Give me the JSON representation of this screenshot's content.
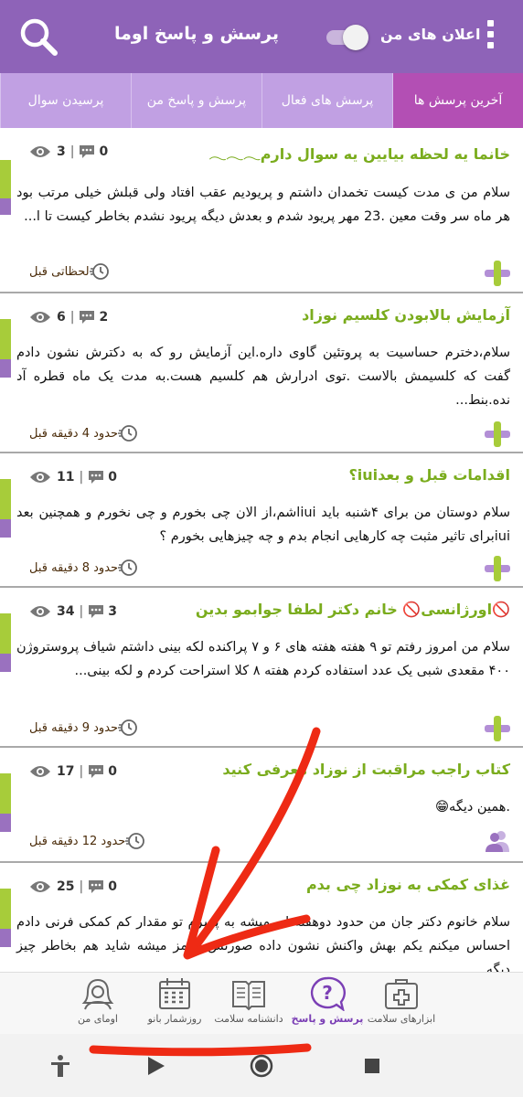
{
  "appbar": {
    "title": "پرسش و پاسخ اوما",
    "notifications_label": "اعلان های من",
    "notifications_on": true
  },
  "tabs": [
    {
      "label": "آخرین پرسش ها",
      "active": true
    },
    {
      "label": "پرسش های فعال",
      "active": false
    },
    {
      "label": "پرسش و پاسخ من",
      "active": false
    },
    {
      "label": "پرسیدن سوال",
      "active": false
    }
  ],
  "questions": [
    {
      "title": "خانما یه لحظه بیایین یه سوال دارم𓂃𓂃𓂃",
      "body": "سلام من ی مدت کیست تخمدان داشتم و پریودیم عقب افتاد ولی قبلش خیلی مرتب بود هر ماه سر وقت معین .23 مهر پریود شدم و بعدش دیگه پریود نشدم بخاطر کیست تا ا...",
      "views": "3",
      "answers": "0",
      "time": "لحظاتی قبل",
      "avatar": "cross-icon"
    },
    {
      "title": "آزمایش بالابودن کلسیم نوزاد",
      "body": "سلام،دخترم حساسیت به پروتئین گاوی داره.این آزمایش رو که به دکترش نشون دادم گفت که کلسیمش بالاست .توی ادرارش هم کلسیم هست.به مدت یک ماه قطره آد نده.بنط...",
      "views": "6",
      "answers": "2",
      "time": "حدود 4 دقیقه قبل",
      "avatar": "cross-icon"
    },
    {
      "title": "اقدامات قبل و بعدiui؟",
      "body": "سلام دوستان  من برای ۴شنبه باید iuiاشم،از الان چی بخورم و چی نخورم و همچنین بعد iuiبرای تاثیر مثبت چه کارهایی انجام بدم و چه چیزهایی بخورم ؟",
      "views": "11",
      "answers": "0",
      "time": "حدود 8 دقیقه قبل",
      "avatar": "cross-icon"
    },
    {
      "title": "🚫اورژانسی🚫 خانم دکتر لطفا جوابمو بدین",
      "body": "سلام من امروز رفتم تو ۹ هفته هفته های ۶ و ۷ پراکنده لکه بینی داشتم شیاف پروستروژن ۴۰۰ مقعدی شبی یک عدد استفاده کردم هفته ۸ کلا استراحت کردم و لکه بینی...",
      "views": "34",
      "answers": "3",
      "time": "حدود 9 دقیقه قبل",
      "avatar": "cross-icon"
    },
    {
      "title": "کتاب راجب مراقبت از نوزاد معرفی کنید",
      "body": ".همین دیگه😁",
      "views": "17",
      "answers": "0",
      "time": "حدود 12 دقیقه قبل",
      "avatar": "user-group-icon"
    },
    {
      "title": "غذای کمکی به نوزاد چی بدم",
      "body": "سلام خانوم دکتر جان من حدود دوهفته ای میشه به پسرم تو مقدار کم کمکی فرنی دادم احساس میکنم یکم بهش واکنش نشون داده صورتش قرمز میشه شاید هم بخاطر چیز دیگه",
      "views": "25",
      "answers": "0",
      "time": "",
      "avatar": "cross-icon"
    }
  ],
  "bottom_nav": [
    {
      "label": "ابزارهای سلامت",
      "icon": "first-aid-kit-icon",
      "active": false
    },
    {
      "label": "پرسش و پاسخ",
      "icon": "question-bubble-icon",
      "active": true
    },
    {
      "label": "دانشنامه سلامت",
      "icon": "open-book-icon",
      "active": false
    },
    {
      "label": "روزشمار بانو",
      "icon": "calendar-icon",
      "active": false
    },
    {
      "label": "اومای من",
      "icon": "woman-profile-icon",
      "active": false
    }
  ],
  "system_nav": [
    "accessibility-icon",
    "play-icon",
    "home-circle-icon",
    "square-icon"
  ],
  "colors": {
    "appbar": "#8e63b8",
    "tab_bar": "#c1a0e3",
    "tab_active": "#b34fb4",
    "title_green": "#7aac1d",
    "annotation_red": "#ee2a14"
  }
}
